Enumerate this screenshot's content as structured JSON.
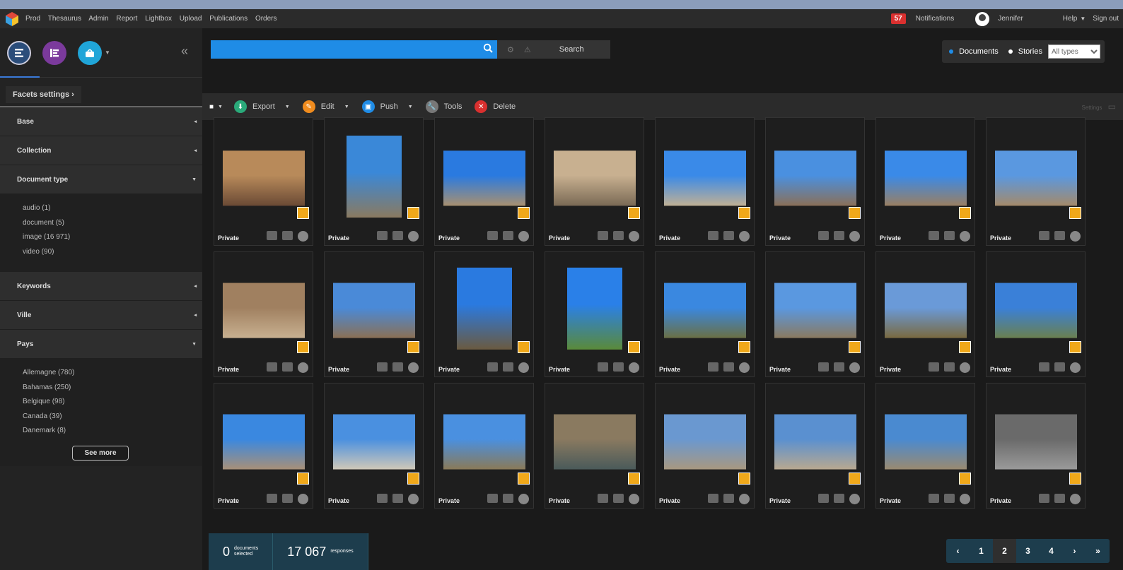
{
  "topbar": {
    "nav": [
      "Prod",
      "Thesaurus",
      "Admin",
      "Report",
      "Lightbox",
      "Upload",
      "Publications",
      "Orders"
    ],
    "notif_count": "57",
    "notifications": "Notifications",
    "user": "Jennifer",
    "help": "Help",
    "signout": "Sign out"
  },
  "sidebar": {
    "facets_settings": "Facets settings",
    "facets": [
      {
        "label": "Base"
      },
      {
        "label": "Collection"
      },
      {
        "label": "Document type",
        "items": [
          "audio (1)",
          "document (5)",
          "image (16 971)",
          "video (90)"
        ]
      },
      {
        "label": "Keywords"
      },
      {
        "label": "Ville"
      },
      {
        "label": "Pays",
        "items": [
          "Allemagne (780)",
          "Bahamas (250)",
          "Belgique (98)",
          "Canada (39)",
          "Danemark (8)"
        ]
      }
    ],
    "see_more": "See more"
  },
  "search": {
    "button": "Search",
    "doc_option": "Documents",
    "stories_option": "Stories",
    "type_select": "All types"
  },
  "toolbar": {
    "export": "Export",
    "edit": "Edit",
    "push": "Push",
    "tools": "Tools",
    "delete": "Delete",
    "settings": "Settings"
  },
  "card_label": "Private",
  "stats": {
    "selected_count": "0",
    "selected_label_1": "documents",
    "selected_label_2": "selected",
    "responses_count": "17 067",
    "responses_label": "responses"
  },
  "pager": [
    "‹",
    "1",
    "2",
    "3",
    "4",
    "›",
    "»"
  ],
  "pager_active": "2",
  "colors": {
    "accent": "#1f8ce6",
    "badge": "#d9302f",
    "stat_bg": "#1d3d4d"
  }
}
